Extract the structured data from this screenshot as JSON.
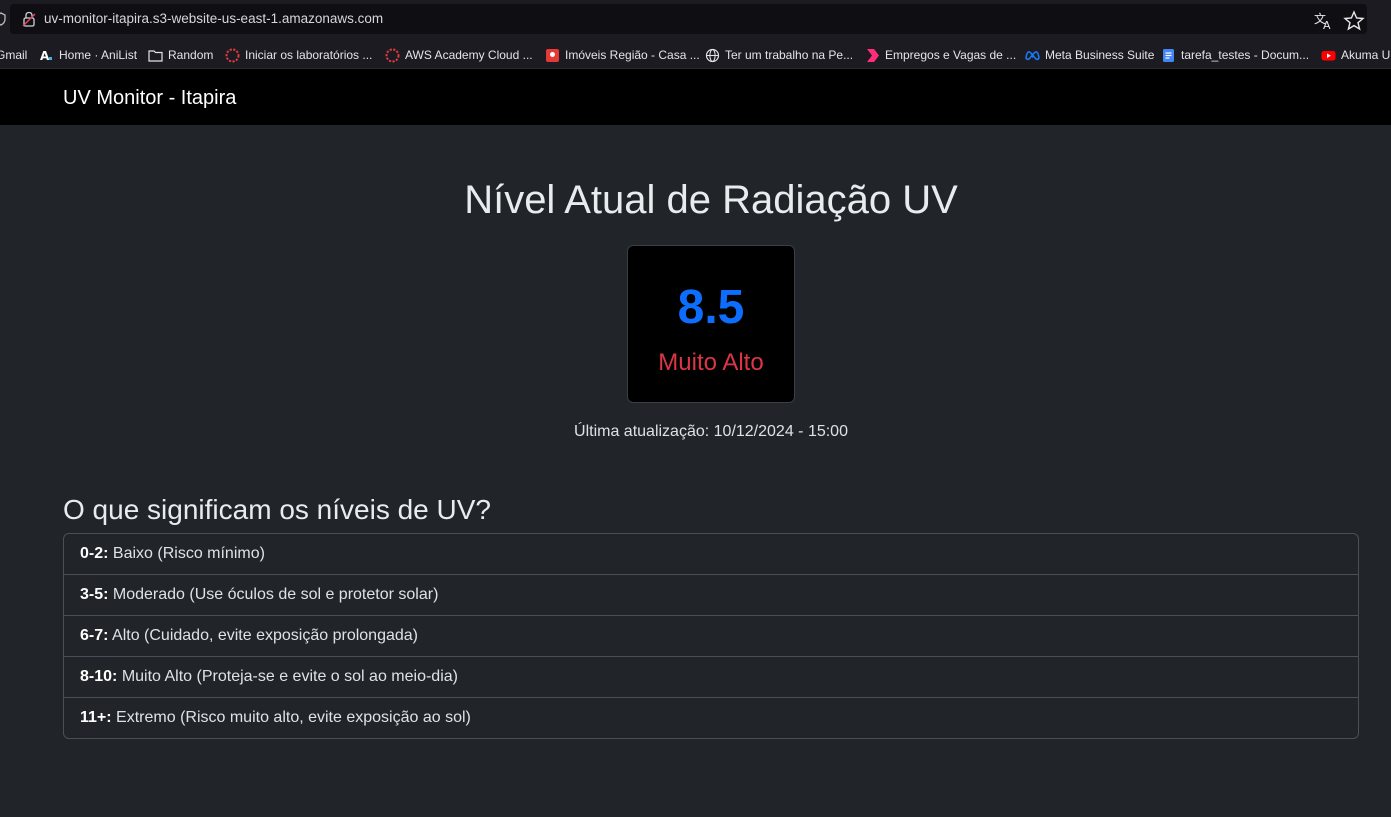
{
  "browser": {
    "url": "uv-monitor-itapira.s3-website-us-east-1.amazonaws.com",
    "bookmarks": [
      {
        "label": "Gmail",
        "icon": "gmail-icon"
      },
      {
        "label": "Home · AniList",
        "icon": "anilist-icon"
      },
      {
        "label": "Random",
        "icon": "folder-icon"
      },
      {
        "label": "Iniciar os laboratórios ...",
        "icon": "aws-academy-icon"
      },
      {
        "label": "AWS Academy Cloud ...",
        "icon": "aws-academy-icon"
      },
      {
        "label": "Imóveis Região - Casa ...",
        "icon": "map-pin-icon"
      },
      {
        "label": "Ter um trabalho na Pe...",
        "icon": "globe-icon"
      },
      {
        "label": "Empregos e Vagas de ...",
        "icon": "chevron-brand-icon"
      },
      {
        "label": "Meta Business Suite",
        "icon": "meta-icon"
      },
      {
        "label": "tarefa_testes - Docum...",
        "icon": "google-docs-icon"
      },
      {
        "label": "Akuma U",
        "icon": "youtube-icon"
      }
    ]
  },
  "navbar": {
    "brand": "UV Monitor - Itapira"
  },
  "hero": {
    "title": "Nível Atual de Radiação UV",
    "uv_value": "8.5",
    "uv_level": "Muito Alto",
    "updated_label": "Última atualização:",
    "updated_value": "10/12/2024 - 15:00"
  },
  "levels": {
    "title": "O que significam os níveis de UV?",
    "items": [
      {
        "range": "0-2:",
        "text": "Baixo (Risco mínimo)"
      },
      {
        "range": "3-5:",
        "text": "Moderado (Use óculos de sol e protetor solar)"
      },
      {
        "range": "6-7:",
        "text": "Alto (Cuidado, evite exposição prolongada)"
      },
      {
        "range": "8-10:",
        "text": "Muito Alto (Proteja-se e evite o sol ao meio-dia)"
      },
      {
        "range": "11+:",
        "text": "Extremo (Risco muito alto, evite exposição ao sol)"
      }
    ]
  },
  "colors": {
    "uv_value": "#0d6efd",
    "uv_level": "#dc3545",
    "background": "#212529",
    "navbar": "#000000"
  }
}
